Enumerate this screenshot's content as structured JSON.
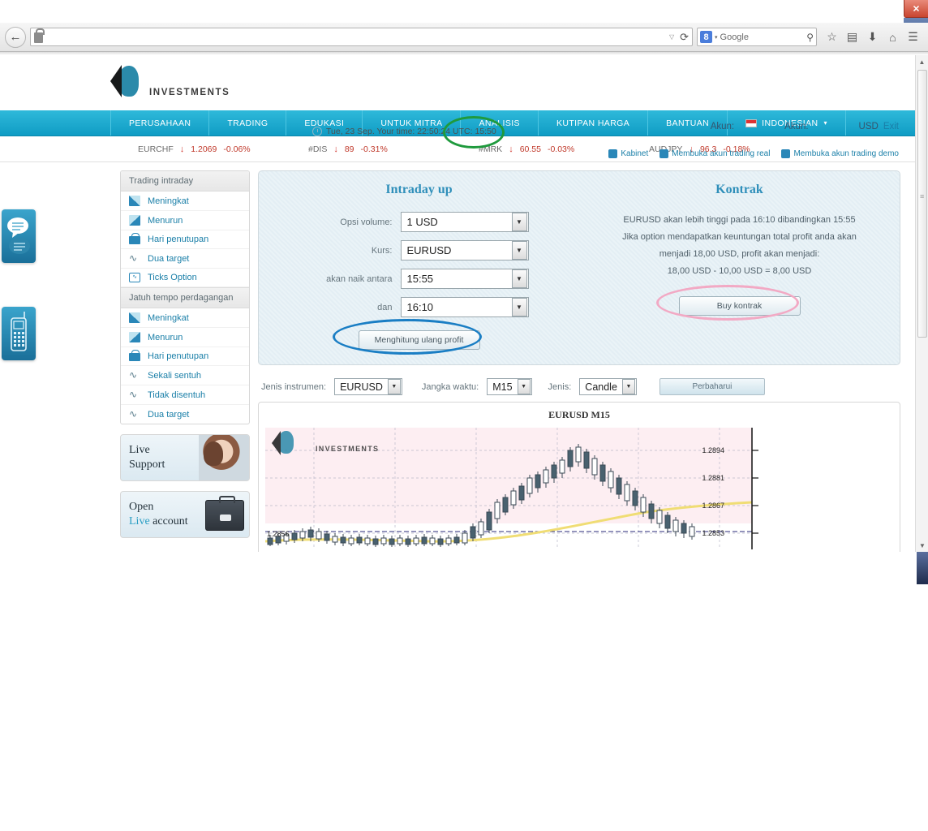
{
  "browser": {
    "url_value": "",
    "url_placeholder": "",
    "reload_glyph": "⟳",
    "dropdown_glyph": "▽",
    "search_engine": "Google",
    "search_badge": "8",
    "back_glyph": "←",
    "toolbar_icons": [
      "star-icon",
      "reader-icon",
      "download-icon",
      "home-icon",
      "menu-icon"
    ]
  },
  "header": {
    "brand": "INVESTMENTS",
    "clock_text": "Tue, 23 Sep. Your time: 22:50:24 UTC: 15:50",
    "account_label_1": "Akun:",
    "account_label_2": "Akun:",
    "currency": "USD",
    "exit": "Exit",
    "links": [
      {
        "label": "Kabinet",
        "icon": "cabinet-icon"
      },
      {
        "label": "Membuka akun trading real",
        "icon": "briefcase-icon"
      },
      {
        "label": "Membuka akun trading demo",
        "icon": "graduation-icon"
      }
    ]
  },
  "mainnav": {
    "items": [
      "PERUSAHAAN",
      "TRADING",
      "EDUKASI",
      "UNTUK MITRA",
      "ANALISIS",
      "KUTIPAN HARGA",
      "BANTUAN"
    ],
    "language": "INDONESIAN",
    "language_caret": "▾"
  },
  "ticker": {
    "arrow": "↓",
    "items": [
      {
        "symbol": "EURCHF",
        "price": "1.2069",
        "change": "-0.06%"
      },
      {
        "symbol": "#DIS",
        "price": "89",
        "change": "-0.31%"
      },
      {
        "symbol": "#MRK",
        "price": "60.55",
        "change": "-0.03%"
      },
      {
        "symbol": "AUDJPY",
        "price": "96.3",
        "change": "-0.18%"
      }
    ]
  },
  "sidebar": {
    "group1_title": "Trading intraday",
    "group1_items": [
      {
        "label": "Meningkat",
        "icon": "bar-up-icon"
      },
      {
        "label": "Menurun",
        "icon": "bar-down-icon"
      },
      {
        "label": "Hari penutupan",
        "icon": "lock-icon"
      },
      {
        "label": "Dua target",
        "icon": "wave-icon"
      },
      {
        "label": "Ticks Option",
        "icon": "monitor-icon"
      }
    ],
    "group2_title": "Jatuh tempo perdagangan",
    "group2_items": [
      {
        "label": "Meningkat",
        "icon": "bar-up-icon"
      },
      {
        "label": "Menurun",
        "icon": "bar-down-icon"
      },
      {
        "label": "Hari penutupan",
        "icon": "lock-icon"
      },
      {
        "label": "Sekali sentuh",
        "icon": "wave-icon"
      },
      {
        "label": "Tidak disentuh",
        "icon": "wave-icon"
      },
      {
        "label": "Dua target",
        "icon": "wave-icon"
      }
    ],
    "promo_support_line1": "Live",
    "promo_support_line2": "Support",
    "promo_account_line1": "Open",
    "promo_account_accent": "Live",
    "promo_account_rest": " account"
  },
  "trade_form": {
    "title": "Intraday up",
    "rows": [
      {
        "label": "Opsi volume:",
        "value": "1 USD"
      },
      {
        "label": "Kurs:",
        "value": "EURUSD"
      },
      {
        "label": "akan naik antara",
        "value": "15:55"
      },
      {
        "label": "dan",
        "value": "16:10"
      }
    ],
    "recalc_button": "Menghitung ulang profit"
  },
  "contract": {
    "title": "Kontrak",
    "line1": "EURUSD akan lebih tinggi pada 16:10 dibandingkan 15:55",
    "line2": "Jika option mendapatkan keuntungan total profit anda akan",
    "line3": "menjadi 18,00 USD, profit akan menjadi:",
    "line4": "18,00 USD - 10,00 USD = 8,00 USD",
    "buy_button": "Buy kontrak"
  },
  "chart_controls": {
    "instrument_label": "Jenis instrumen:",
    "instrument_value": "EURUSD",
    "timeframe_label": "Jangka waktu:",
    "timeframe_value": "M15",
    "type_label": "Jenis:",
    "type_value": "Candle",
    "refresh_button": "Perbaharui"
  },
  "chart_data": {
    "type": "line",
    "title": "EURUSD M15",
    "watermark": "INVESTMENTS",
    "xlabel": "",
    "ylabel": "",
    "grid": true,
    "legend": "none",
    "ylim": [
      1.2846,
      1.2901
    ],
    "y_ticks": [
      "1.2894",
      "1.2881",
      "1.2867",
      "1.2853"
    ],
    "level_line_label": "1.2856",
    "series": [
      {
        "name": "EURUSD candles (close)",
        "values": [
          1.2857,
          1.2856,
          1.2858,
          1.286,
          1.2862,
          1.2861,
          1.2859,
          1.2858,
          1.2857,
          1.2856,
          1.2857,
          1.2858,
          1.2856,
          1.2855,
          1.2856,
          1.2855,
          1.2857,
          1.2856,
          1.2855,
          1.2856,
          1.2857,
          1.2856,
          1.2855,
          1.2856,
          1.2858,
          1.2862,
          1.2866,
          1.2868,
          1.2872,
          1.287,
          1.2874,
          1.2876,
          1.288,
          1.2878,
          1.2882,
          1.2884,
          1.2887,
          1.2886,
          1.2889,
          1.2891,
          1.2888,
          1.2884,
          1.2881,
          1.2878,
          1.2874,
          1.2871,
          1.2868,
          1.2866,
          1.2864,
          1.2862,
          1.2861,
          1.286,
          1.2859
        ]
      },
      {
        "name": "moving average",
        "values": [
          1.2849,
          1.285,
          1.2851,
          1.2851,
          1.2852,
          1.2852,
          1.2853,
          1.2853,
          1.2854,
          1.2854,
          1.2855,
          1.2855,
          1.2856,
          1.2856,
          1.2857,
          1.2858,
          1.2859,
          1.286,
          1.2861,
          1.2862,
          1.2863,
          1.2864,
          1.2865,
          1.2866,
          1.2867,
          1.2867,
          1.2868,
          1.2868
        ]
      }
    ]
  }
}
